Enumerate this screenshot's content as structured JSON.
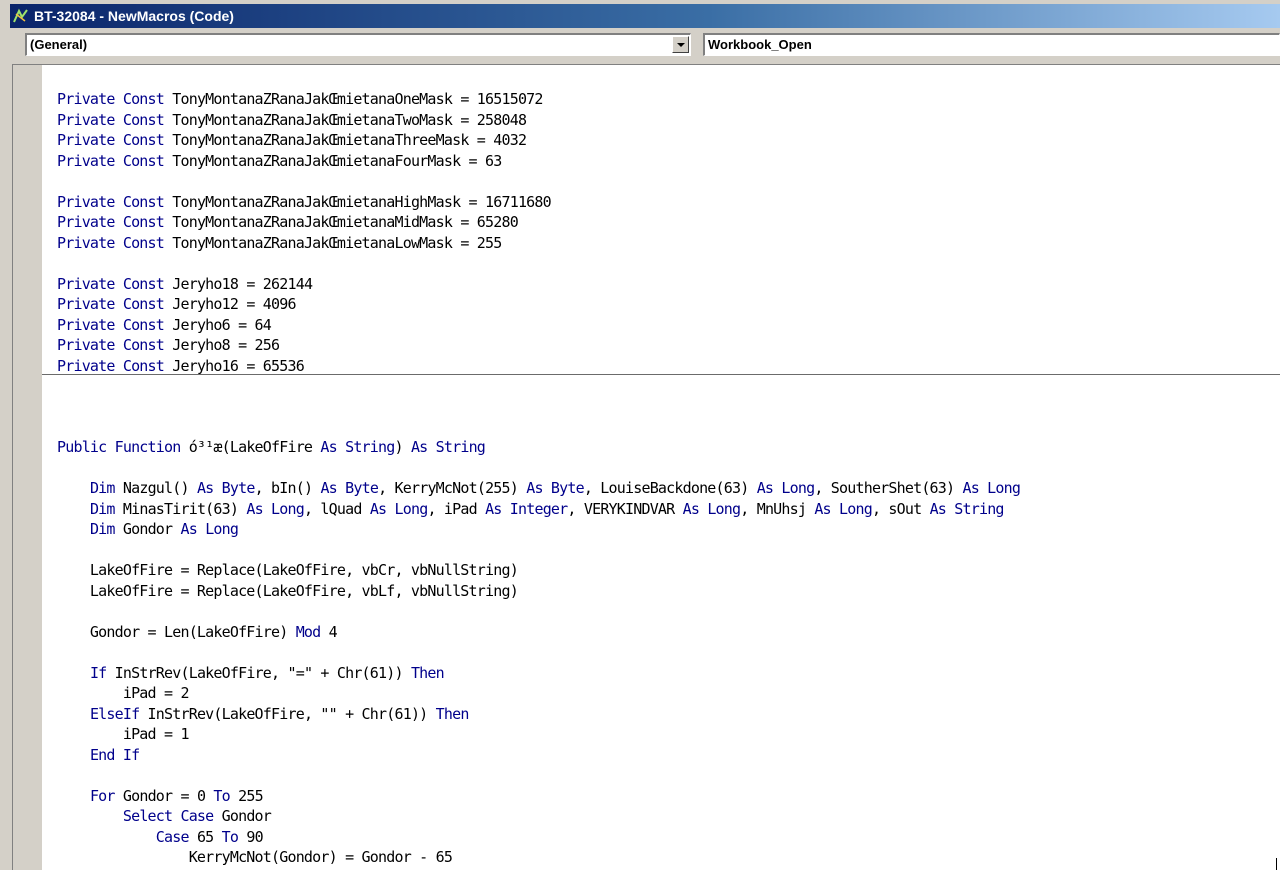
{
  "window": {
    "title": "BT-32084 - NewMacros (Code)",
    "icon": "vba-editor-icon"
  },
  "object_combo": {
    "selected": "(General)"
  },
  "procedure_combo": {
    "selected": "Workbook_Open"
  },
  "colors": {
    "keyword": "#00008b",
    "text": "#000000",
    "title_start": "#0a246a",
    "title_end": "#a6caf0"
  },
  "declarations": [
    [
      {
        "k": true,
        "t": "Private Const"
      },
      {
        "k": false,
        "t": " TonyMontanaZRanaJakŒmietanaOneMask = 16515072"
      }
    ],
    [
      {
        "k": true,
        "t": "Private Const"
      },
      {
        "k": false,
        "t": " TonyMontanaZRanaJakŒmietanaTwoMask = 258048"
      }
    ],
    [
      {
        "k": true,
        "t": "Private Const"
      },
      {
        "k": false,
        "t": " TonyMontanaZRanaJakŒmietanaThreeMask = 4032"
      }
    ],
    [
      {
        "k": true,
        "t": "Private Const"
      },
      {
        "k": false,
        "t": " TonyMontanaZRanaJakŒmietanaFourMask = 63"
      }
    ],
    [],
    [
      {
        "k": true,
        "t": "Private Const"
      },
      {
        "k": false,
        "t": " TonyMontanaZRanaJakŒmietanaHighMask = 16711680"
      }
    ],
    [
      {
        "k": true,
        "t": "Private Const"
      },
      {
        "k": false,
        "t": " TonyMontanaZRanaJakŒmietanaMidMask = 65280"
      }
    ],
    [
      {
        "k": true,
        "t": "Private Const"
      },
      {
        "k": false,
        "t": " TonyMontanaZRanaJakŒmietanaLowMask = 255"
      }
    ],
    [],
    [
      {
        "k": true,
        "t": "Private Const"
      },
      {
        "k": false,
        "t": " Jeryho18 = 262144"
      }
    ],
    [
      {
        "k": true,
        "t": "Private Const"
      },
      {
        "k": false,
        "t": " Jeryho12 = 4096"
      }
    ],
    [
      {
        "k": true,
        "t": "Private Const"
      },
      {
        "k": false,
        "t": " Jeryho6 = 64"
      }
    ],
    [
      {
        "k": true,
        "t": "Private Const"
      },
      {
        "k": false,
        "t": " Jeryho8 = 256"
      }
    ],
    [
      {
        "k": true,
        "t": "Private Const"
      },
      {
        "k": false,
        "t": " Jeryho16 = 65536"
      }
    ]
  ],
  "procedure": [
    [
      {
        "k": true,
        "t": "Public Function"
      },
      {
        "k": false,
        "t": " ó³¹æ(LakeOfFire "
      },
      {
        "k": true,
        "t": "As String"
      },
      {
        "k": false,
        "t": ") "
      },
      {
        "k": true,
        "t": "As String"
      }
    ],
    [],
    [
      {
        "k": false,
        "t": "    "
      },
      {
        "k": true,
        "t": "Dim"
      },
      {
        "k": false,
        "t": " Nazgul() "
      },
      {
        "k": true,
        "t": "As Byte"
      },
      {
        "k": false,
        "t": ", bIn() "
      },
      {
        "k": true,
        "t": "As Byte"
      },
      {
        "k": false,
        "t": ", KerryMcNot(255) "
      },
      {
        "k": true,
        "t": "As Byte"
      },
      {
        "k": false,
        "t": ", LouiseBackdone(63) "
      },
      {
        "k": true,
        "t": "As Long"
      },
      {
        "k": false,
        "t": ", SoutherShet(63) "
      },
      {
        "k": true,
        "t": "As Long"
      }
    ],
    [
      {
        "k": false,
        "t": "    "
      },
      {
        "k": true,
        "t": "Dim"
      },
      {
        "k": false,
        "t": " MinasTirit(63) "
      },
      {
        "k": true,
        "t": "As Long"
      },
      {
        "k": false,
        "t": ", lQuad "
      },
      {
        "k": true,
        "t": "As Long"
      },
      {
        "k": false,
        "t": ", iPad "
      },
      {
        "k": true,
        "t": "As Integer"
      },
      {
        "k": false,
        "t": ", VERYKINDVAR "
      },
      {
        "k": true,
        "t": "As Long"
      },
      {
        "k": false,
        "t": ", MnUhsj "
      },
      {
        "k": true,
        "t": "As Long"
      },
      {
        "k": false,
        "t": ", sOut "
      },
      {
        "k": true,
        "t": "As String"
      }
    ],
    [
      {
        "k": false,
        "t": "    "
      },
      {
        "k": true,
        "t": "Dim"
      },
      {
        "k": false,
        "t": " Gondor "
      },
      {
        "k": true,
        "t": "As Long"
      }
    ],
    [],
    [
      {
        "k": false,
        "t": "    LakeOfFire = Replace(LakeOfFire, vbCr, vbNullString)"
      }
    ],
    [
      {
        "k": false,
        "t": "    LakeOfFire = Replace(LakeOfFire, vbLf, vbNullString)"
      }
    ],
    [],
    [
      {
        "k": false,
        "t": "    Gondor = Len(LakeOfFire) "
      },
      {
        "k": true,
        "t": "Mod"
      },
      {
        "k": false,
        "t": " 4"
      }
    ],
    [],
    [
      {
        "k": false,
        "t": "    "
      },
      {
        "k": true,
        "t": "If"
      },
      {
        "k": false,
        "t": " InStrRev(LakeOfFire, \"=\" + Chr(61)) "
      },
      {
        "k": true,
        "t": "Then"
      }
    ],
    [
      {
        "k": false,
        "t": "        iPad = 2"
      }
    ],
    [
      {
        "k": false,
        "t": "    "
      },
      {
        "k": true,
        "t": "ElseIf"
      },
      {
        "k": false,
        "t": " InStrRev(LakeOfFire, \"\" + Chr(61)) "
      },
      {
        "k": true,
        "t": "Then"
      }
    ],
    [
      {
        "k": false,
        "t": "        iPad = 1"
      }
    ],
    [
      {
        "k": false,
        "t": "    "
      },
      {
        "k": true,
        "t": "End If"
      }
    ],
    [],
    [
      {
        "k": false,
        "t": "    "
      },
      {
        "k": true,
        "t": "For"
      },
      {
        "k": false,
        "t": " Gondor = 0 "
      },
      {
        "k": true,
        "t": "To"
      },
      {
        "k": false,
        "t": " 255"
      }
    ],
    [
      {
        "k": false,
        "t": "        "
      },
      {
        "k": true,
        "t": "Select Case"
      },
      {
        "k": false,
        "t": " Gondor"
      }
    ],
    [
      {
        "k": false,
        "t": "            "
      },
      {
        "k": true,
        "t": "Case"
      },
      {
        "k": false,
        "t": " 65 "
      },
      {
        "k": true,
        "t": "To"
      },
      {
        "k": false,
        "t": " 90"
      }
    ],
    [
      {
        "k": false,
        "t": "                KerryMcNot(Gondor) = Gondor - 65"
      }
    ]
  ]
}
